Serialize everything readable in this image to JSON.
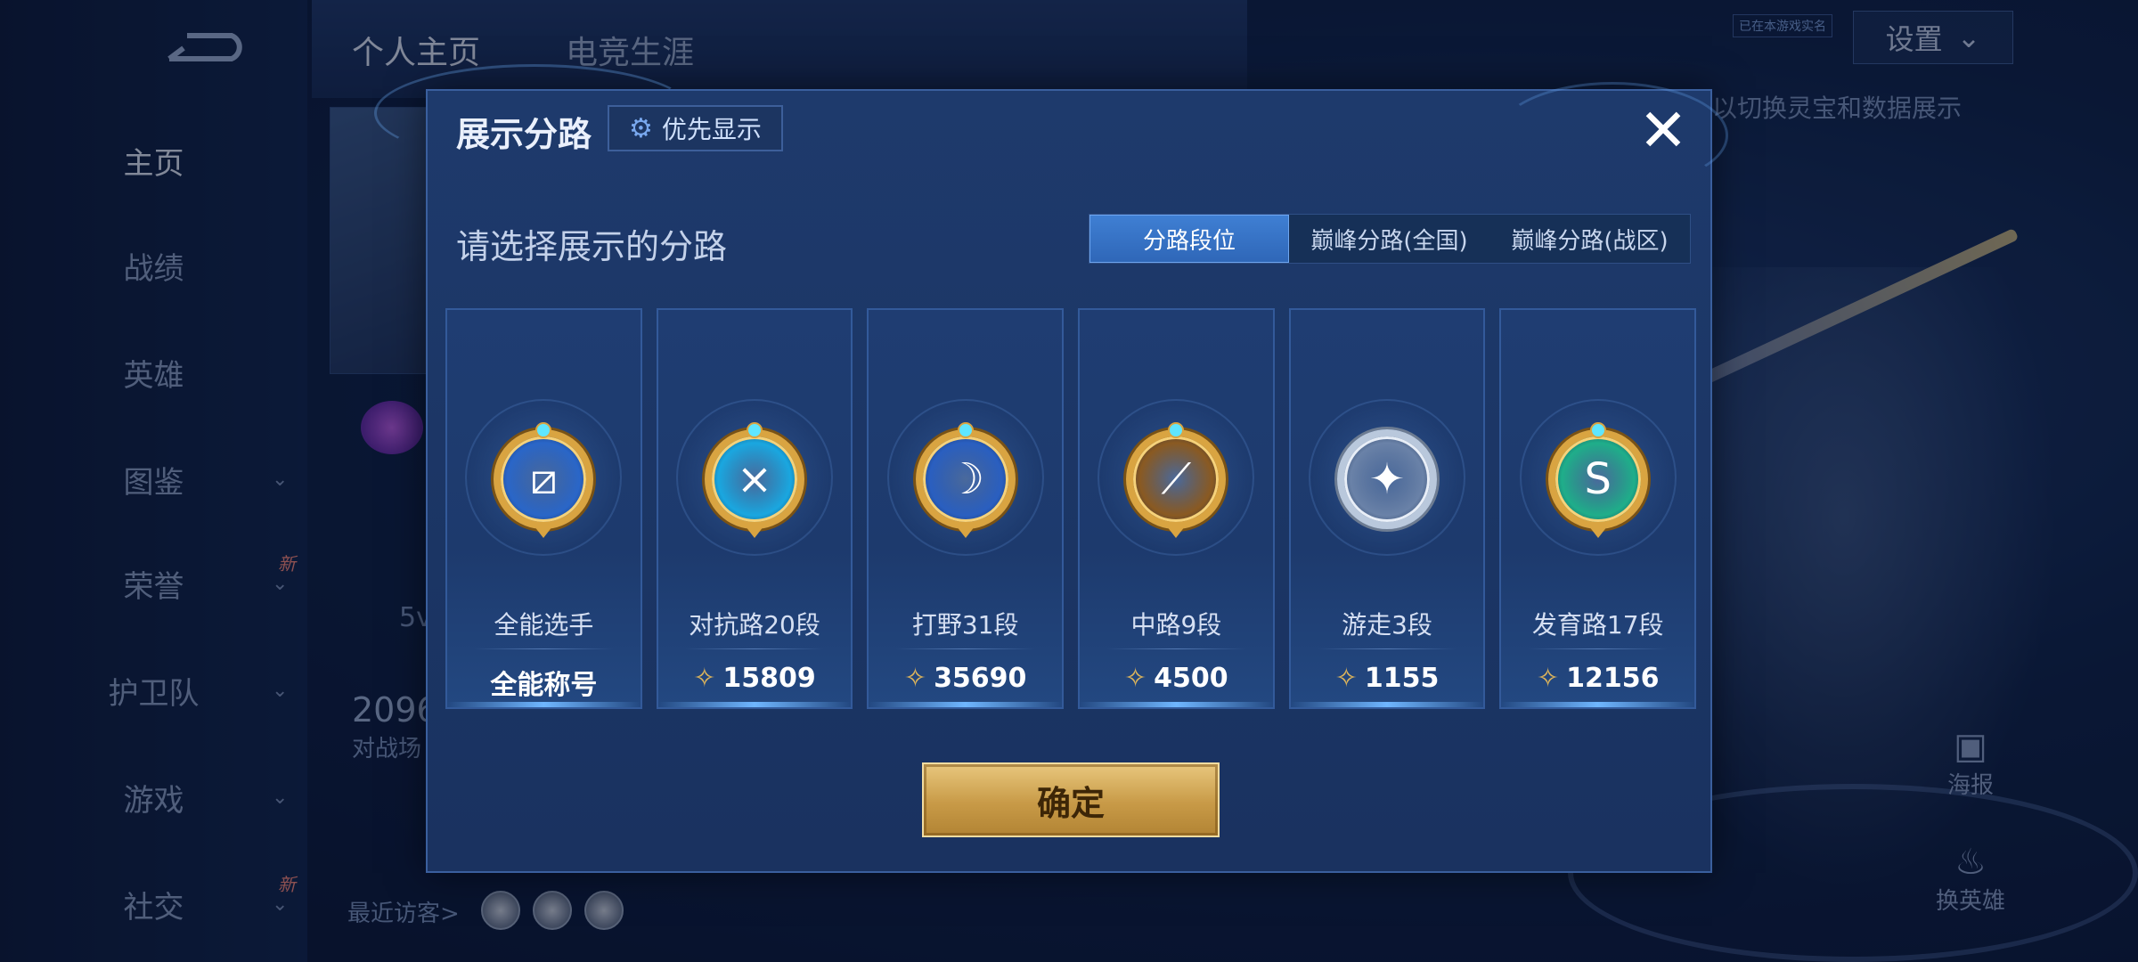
{
  "background": {
    "sidebar": {
      "items": [
        {
          "label": "主页",
          "active": true,
          "chevron": false,
          "new": false
        },
        {
          "label": "战绩",
          "active": false,
          "chevron": false,
          "new": false
        },
        {
          "label": "英雄",
          "active": false,
          "chevron": false,
          "new": false
        },
        {
          "label": "图鉴",
          "active": false,
          "chevron": true,
          "new": false
        },
        {
          "label": "荣誉",
          "active": false,
          "chevron": true,
          "new": true
        },
        {
          "label": "护卫队",
          "active": false,
          "chevron": true,
          "new": false
        },
        {
          "label": "游戏",
          "active": false,
          "chevron": true,
          "new": false
        },
        {
          "label": "社交",
          "active": false,
          "chevron": true,
          "new": true
        }
      ],
      "new_badge": "新"
    },
    "top_tabs": [
      "个人主页",
      "电竞生涯"
    ],
    "settings_label": "设置",
    "hint_text": "以切换灵宝和数据展示",
    "small_tag": "已在本游戏实名",
    "number_partial": "2096",
    "subtext_partial": "对战场",
    "recent_visitors_label": "最近访客>",
    "right_icons": [
      {
        "label": "海报"
      },
      {
        "label": "换英雄"
      }
    ],
    "partial_label_5v": "5v"
  },
  "dialog": {
    "title": "展示分路",
    "priority_label": "优先显示",
    "subtitle": "请选择展示的分路",
    "tabs": [
      {
        "label": "分路段位",
        "active": true
      },
      {
        "label": "巅峰分路(全国)",
        "active": false
      },
      {
        "label": "巅峰分路(战区)",
        "active": false
      }
    ],
    "cards": [
      {
        "label": "全能选手",
        "score": "全能称号",
        "show_score_icon": false,
        "emblem_glyph": "⧄",
        "emblem_fill": "#2a66c8",
        "silver": false
      },
      {
        "label": "对抗路20段",
        "score": "15809",
        "show_score_icon": true,
        "emblem_glyph": "⨯",
        "emblem_fill": "#1aa7e0",
        "silver": false
      },
      {
        "label": "打野31段",
        "score": "35690",
        "show_score_icon": true,
        "emblem_glyph": "☽",
        "emblem_fill": "#2a5fc0",
        "silver": false
      },
      {
        "label": "中路9段",
        "score": "4500",
        "show_score_icon": true,
        "emblem_glyph": "⟋",
        "emblem_fill": "#8a5a22",
        "silver": false
      },
      {
        "label": "游走3段",
        "score": "1155",
        "show_score_icon": true,
        "emblem_glyph": "✦",
        "emblem_fill": "#6a82a8",
        "silver": true
      },
      {
        "label": "发育路17段",
        "score": "12156",
        "show_score_icon": true,
        "emblem_glyph": "S",
        "emblem_fill": "#1fae8a",
        "silver": false
      }
    ],
    "confirm_label": "确定"
  },
  "colors": {
    "accent_blue": "#3f7fd3",
    "gold": "#d9a441",
    "dialog_bg": "#1e3a6c"
  }
}
